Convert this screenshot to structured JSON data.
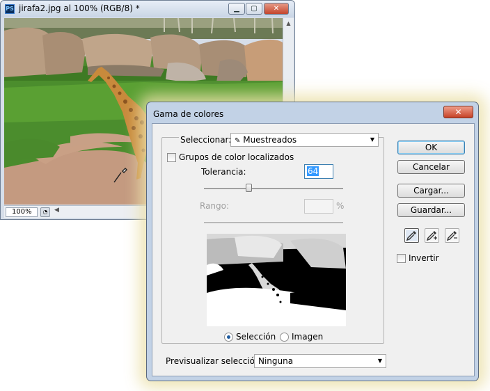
{
  "document_window": {
    "app_icon": "PS",
    "title": "jirafa2.jpg al 100% (RGB/8) *",
    "minimize_icon": "minimize-icon",
    "maximize_icon": "maximize-icon",
    "close_icon": "close-icon",
    "zoom": "100%"
  },
  "dialog": {
    "title": "Gama de colores",
    "close_symbol": "✕",
    "select_label": "Seleccionar:",
    "select_value": "Muestreados",
    "localized_label": "Grupos de color localizados",
    "tolerance_label": "Tolerancia:",
    "tolerance_value": "64",
    "tolerance_fraction": 0.32,
    "range_label": "Rango:",
    "range_value": "",
    "range_unit": "%",
    "radio_selection": "Selección",
    "radio_image": "Imagen",
    "preview_label": "Previsualizar selección:",
    "preview_value": "Ninguna",
    "buttons": {
      "ok": "OK",
      "cancel": "Cancelar",
      "load": "Cargar...",
      "save": "Guardar..."
    },
    "invert_label": "Invertir"
  },
  "colors": {
    "accent": "#3c7fb1",
    "close_red": "#c64126",
    "dialog_frame": "#c2d2e6"
  }
}
